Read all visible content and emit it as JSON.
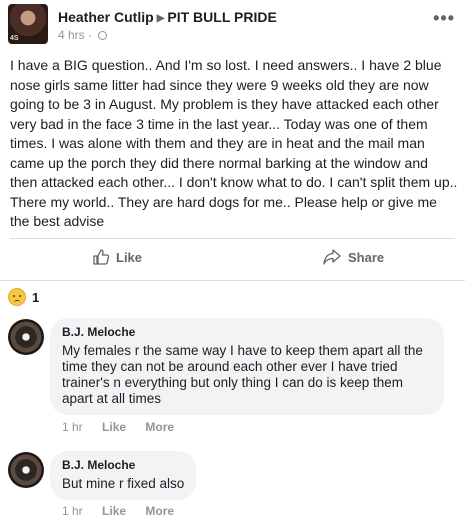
{
  "post": {
    "author": "Heather Cutlip",
    "group": "PIT BULL PRIDE",
    "time": "4 hrs",
    "dot": "·",
    "more": "•••",
    "avatar_text": "4S",
    "body": "I have a BIG question.. And I'm so lost. I need answers.. I have 2 blue nose girls same litter had since they were 9 weeks old they are now going to be 3 in August. My problem is they have attacked each other very bad in the face 3 time in the last year... Today was one of them times. I was alone with them and they are in heat and the mail man came up the porch they did there normal barking at the window and then attacked each other... I don't know what to do. I can't split them up.. There my world.. They are hard dogs for me.. Please help or give me the best advise"
  },
  "actions": {
    "like": "Like",
    "share": "Share"
  },
  "reactions": {
    "count": "1",
    "icon": "sad-reaction-icon"
  },
  "comments": [
    {
      "author": "B.J. Meloche",
      "text": "My females r the same way I have to keep them apart all the time they can not be around each other ever I have tried trainer's n everything but only thing I can do is keep them apart at all times",
      "time": "1 hr",
      "like": "Like",
      "more": "More"
    },
    {
      "author": "B.J. Meloche",
      "text": "But mine r fixed also",
      "time": "1 hr",
      "like": "Like",
      "more": "More"
    }
  ],
  "colors": {
    "text": "#1c1e21",
    "secondary": "#90949c",
    "bubble": "#f2f3f5",
    "divider": "#dadde1"
  }
}
